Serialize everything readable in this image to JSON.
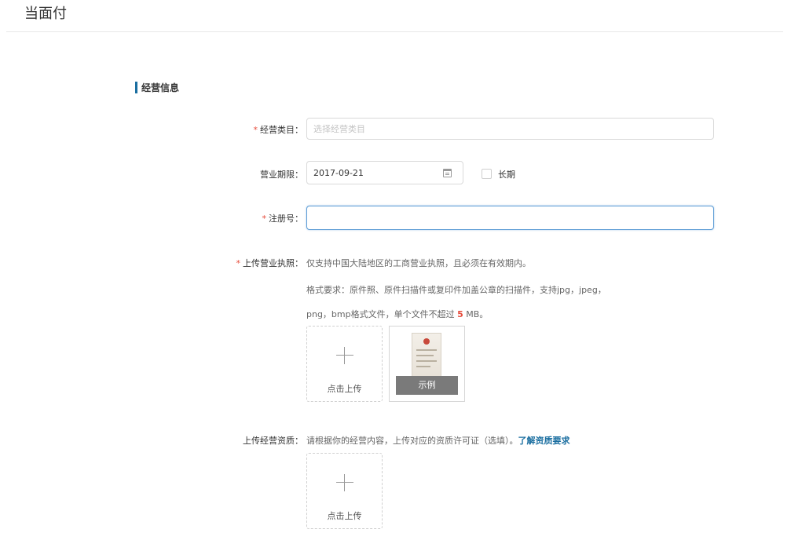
{
  "header": {
    "title": "当面付"
  },
  "section": {
    "title": "经营信息"
  },
  "form": {
    "required_mark": "*",
    "category": {
      "label": "经营类目：",
      "placeholder": "选择经营类目"
    },
    "term": {
      "label": "营业期限：",
      "date_value": "2017-09-21",
      "long_term_label": "长期"
    },
    "reg_no": {
      "label": "注册号：",
      "value": ""
    },
    "license": {
      "label": "上传营业执照：",
      "help_line1": "仅支持中国大陆地区的工商营业执照，且必须在有效期内。",
      "help_line2": "格式要求：原件照、原件扫描件或复印件加盖公章的扫描件，支持jpg，jpeg，",
      "help_line3_prefix": "png，bmp格式文件，单个文件不超过",
      "help_line3_size": "5",
      "help_line3_suffix": "MB。",
      "upload_label": "点击上传",
      "example_label": "示例"
    },
    "qualification": {
      "label": "上传经营资质：",
      "help_text": "请根据你的经营内容，上传对应的资质许可证（选填）。",
      "help_link": "了解资质要求",
      "upload_label": "点击上传"
    }
  }
}
